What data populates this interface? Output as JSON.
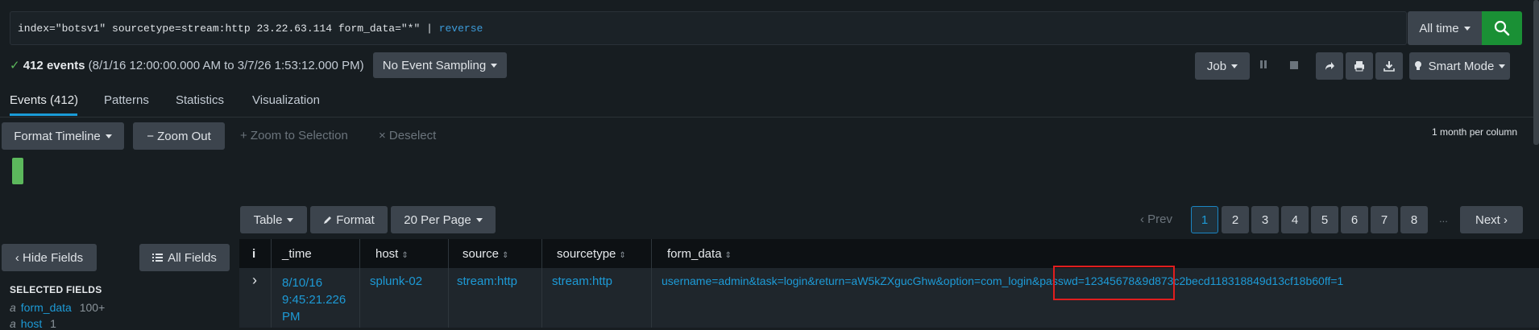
{
  "search": {
    "query_main": "index=\"botsv1\" sourcetype=stream:http 23.22.63.114 form_data=\"*\" | ",
    "query_cmd": "reverse",
    "time_range": "All time"
  },
  "status": {
    "check": "✓",
    "events_count": "412 events",
    "range": "(8/1/16 12:00:00.000 AM to 3/7/26 1:53:12.000 PM)",
    "sampling": "No Event Sampling"
  },
  "toolbar": {
    "job": "Job",
    "mode": "Smart Mode"
  },
  "tabs": [
    {
      "label": "Events (412)"
    },
    {
      "label": "Patterns"
    },
    {
      "label": "Statistics"
    },
    {
      "label": "Visualization"
    }
  ],
  "timeline": {
    "format": "Format Timeline",
    "zoom_out": "− Zoom Out",
    "zoom_selection": "+ Zoom to Selection",
    "deselect": "× Deselect",
    "scale": "1 month per column"
  },
  "results_toolbar": {
    "table": "Table",
    "format": "Format",
    "per_page": "20 Per Page",
    "prev": "‹ Prev",
    "next": "Next ›",
    "pages": [
      "1",
      "2",
      "3",
      "4",
      "5",
      "6",
      "7",
      "8"
    ],
    "ellipsis": "..."
  },
  "sidebar": {
    "hide_fields": "‹ Hide Fields",
    "all_fields": "All Fields",
    "selected_label": "SELECTED FIELDS",
    "fields": [
      {
        "type": "a",
        "name": "form_data",
        "count": "100+"
      },
      {
        "type": "a",
        "name": "host",
        "count": "1"
      }
    ]
  },
  "table": {
    "headers": [
      "i",
      "_time",
      "host",
      "source",
      "sourcetype",
      "form_data"
    ],
    "rows": [
      {
        "expand": "›",
        "time": [
          "8/10/16",
          "9:45:21.226",
          "PM"
        ],
        "host": "splunk-02",
        "source": "stream:http",
        "sourcetype": "stream:http",
        "form_data": "username=admin&task=login&return=aW5kZXgucGhw&option=com_login&passwd=12345678&9d873c2becd118318849d13cf18b60ff=1"
      }
    ]
  },
  "colors": {
    "accent": "#1d9ad6",
    "search_green": "#1a9035",
    "highlight": "#e01e1e"
  }
}
